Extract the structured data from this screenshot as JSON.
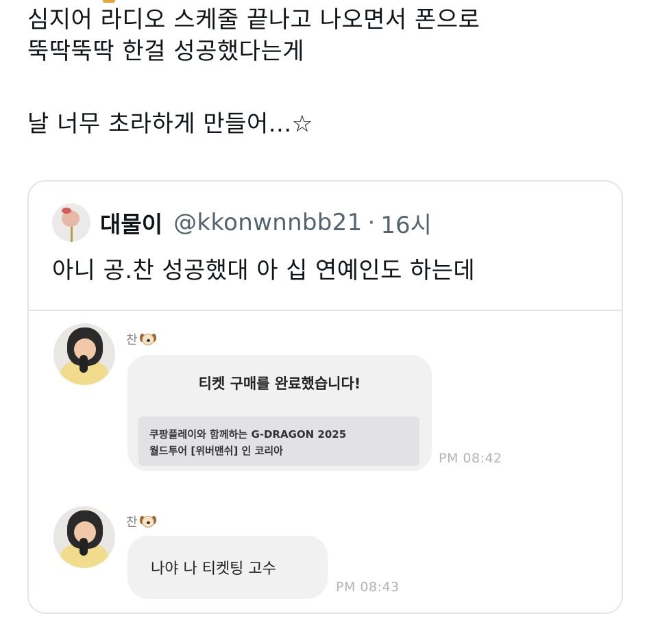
{
  "tweet": {
    "lines": [
      "심지어 라디오 스케줄 끝나고 나오면서 폰으로",
      "뚝딱뚝딱 한걸 성공했다는게",
      "날 너무 초라하게 만들어...☆"
    ]
  },
  "quote": {
    "display_name": "대물이",
    "handle": "@kkonwnnbb21",
    "separator": "·",
    "time": "16시",
    "text": "아니 공.찬 성공했대 아 십 연예인도 하는데"
  },
  "chat": {
    "messages": [
      {
        "sender": "찬",
        "sender_icon": "dog-face-icon",
        "title": "티켓 구매를 완료했습니다!",
        "detail_lines": [
          "쿠팡플레이와 함께하는 G-DRAGON 2025",
          "월드투어 [위버맨쉬] 인 코리아"
        ],
        "time": "PM 08:42"
      },
      {
        "sender": "찬",
        "sender_icon": "dog-face-icon",
        "text": "나야 나 티켓팅 고수",
        "time": "PM 08:43"
      }
    ]
  },
  "colors": {
    "text": "#0f1419",
    "secondary": "#536471",
    "border": "#e1e5e9",
    "bubble": "#f1f1f2",
    "timestamp": "#b3b3b3"
  }
}
